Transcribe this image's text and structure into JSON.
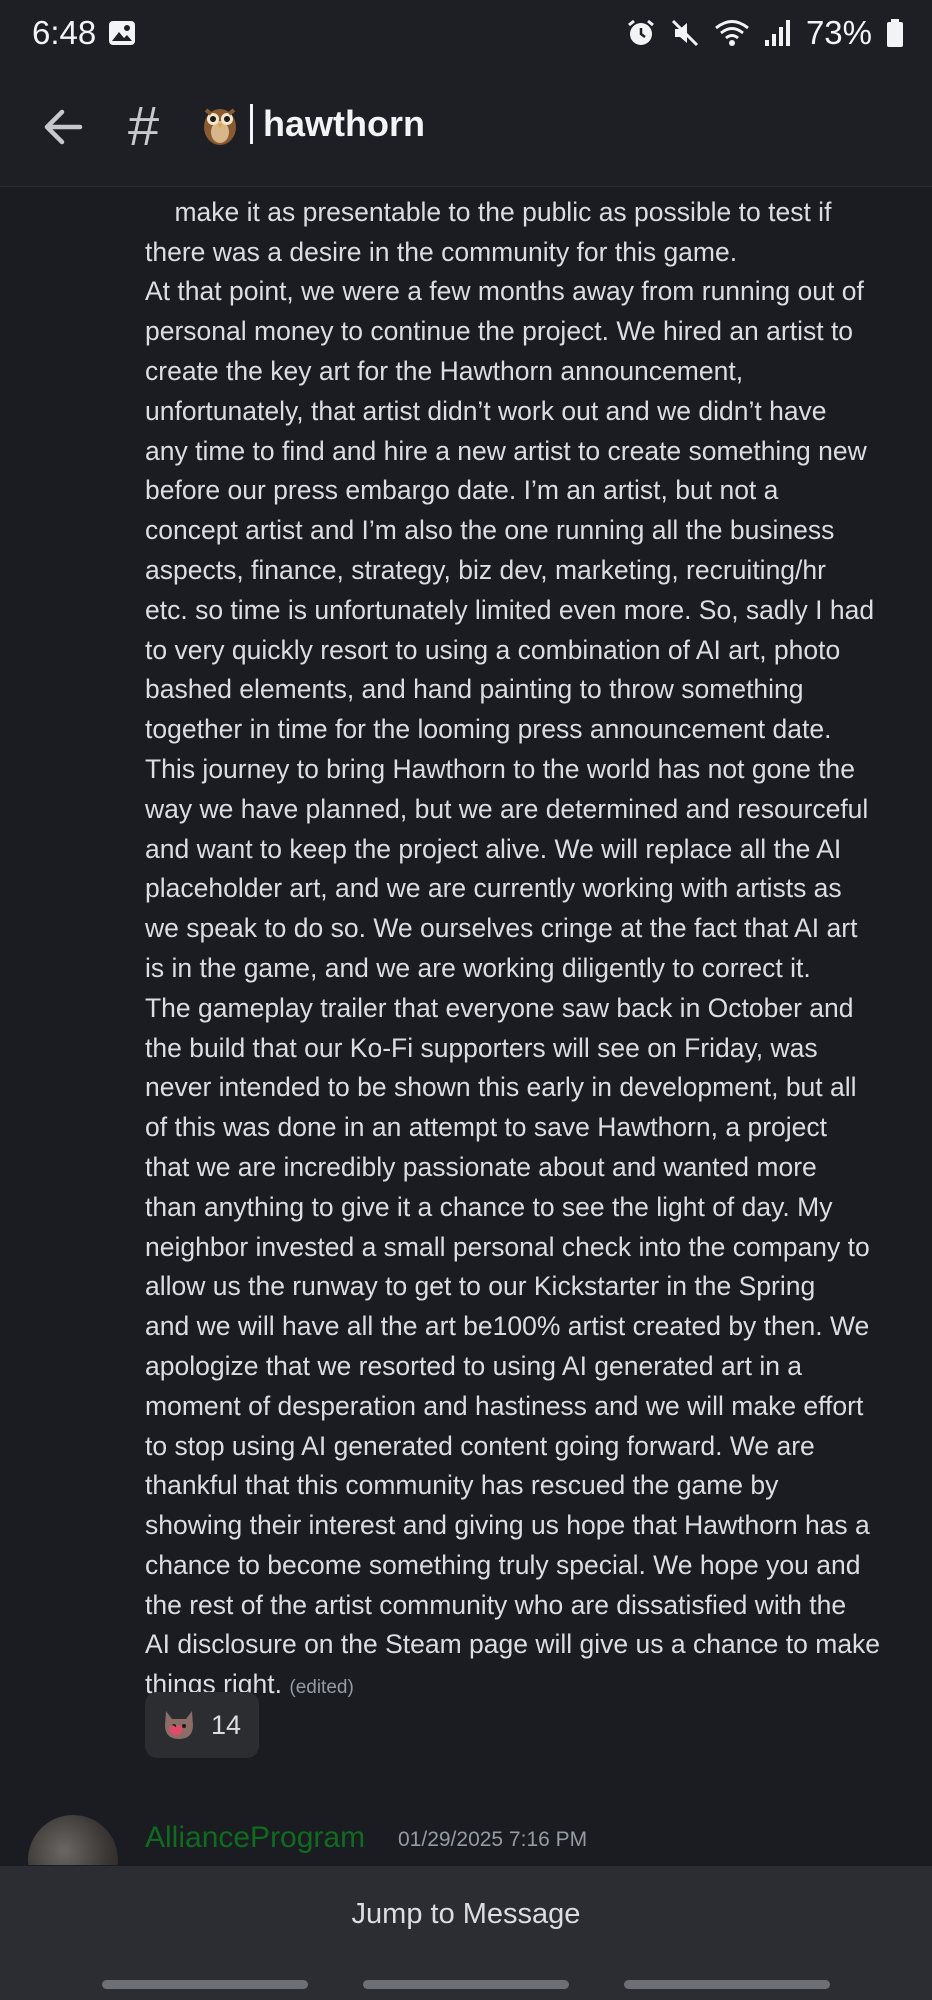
{
  "status_bar": {
    "time": "6:48",
    "battery_percent": "73%",
    "icons": [
      "gallery-icon",
      "alarm-icon",
      "mute-icon",
      "wifi-icon",
      "signal-icon",
      "battery-icon"
    ]
  },
  "header": {
    "back_icon": "arrow-left-icon",
    "channel_icon": "hash-icon",
    "channel_emoji": "owl-icon",
    "channel_name": "hawthorn"
  },
  "message": {
    "lines": [
      "make it as presentable to the public as possible to test if",
      "there was a desire in the community for this game.",
      "At that point, we were a few months away from running out of",
      "personal money to continue the project. We hired an artist to",
      "create the key art for the Hawthorn announcement,",
      "unfortunately, that artist didn’t work out and we didn’t have",
      "any time to find and hire a new artist to create something new",
      "before our press embargo date. I’m an artist, but not a",
      "concept artist and I’m also the one running all the business",
      "aspects, finance, strategy, biz dev, marketing, recruiting/hr",
      "etc. so time is unfortunately limited even more. So, sadly I had",
      "to very quickly resort to using a combination of AI art, photo",
      "bashed elements, and hand painting to throw something",
      "together in time for the looming press announcement date.",
      "This journey to bring Hawthorn to the world has not gone the",
      "way we have planned, but we are determined and resourceful",
      "and want to keep the project alive. We will replace all the AI",
      "placeholder art, and we are currently working with artists as",
      "we speak to do so. We ourselves cringe at the fact that AI art",
      "is in the game, and we are working diligently to correct it.",
      "The gameplay trailer that everyone saw back in October and",
      "the build that our Ko-Fi supporters will see on Friday, was",
      "never intended to be shown this early in development, but all",
      "of this was done in an attempt to save Hawthorn, a project",
      "that we are incredibly passionate about and wanted more",
      "than anything to give it a chance to see the light of day. My",
      "neighbor invested a small personal check into the company to",
      "allow us the runway to get to our Kickstarter in the Spring",
      "and we will have all the art be100% artist created by then. We",
      "apologize that we resorted to using AI generated art in a",
      "moment of desperation and hastiness and we will make effort",
      "to stop using AI generated content going forward. We are",
      "thankful that this community has rescued the game by",
      "showing their interest and giving us hope that Hawthorn has a",
      "chance to become something truly special. We hope you and",
      "the rest of the artist community who are dissatisfied with the",
      "AI disclosure on the Steam page will give us a chance to make",
      "things right."
    ],
    "edited_label": "(edited)",
    "reaction": {
      "emoji": "cat-heart-icon",
      "count": "14"
    }
  },
  "next_message": {
    "author": "AllianceProgram",
    "author_color": "#0e6b1f",
    "timestamp": "01/29/2025 7:16 PM"
  },
  "footer": {
    "jump_label": "Jump to Message"
  }
}
